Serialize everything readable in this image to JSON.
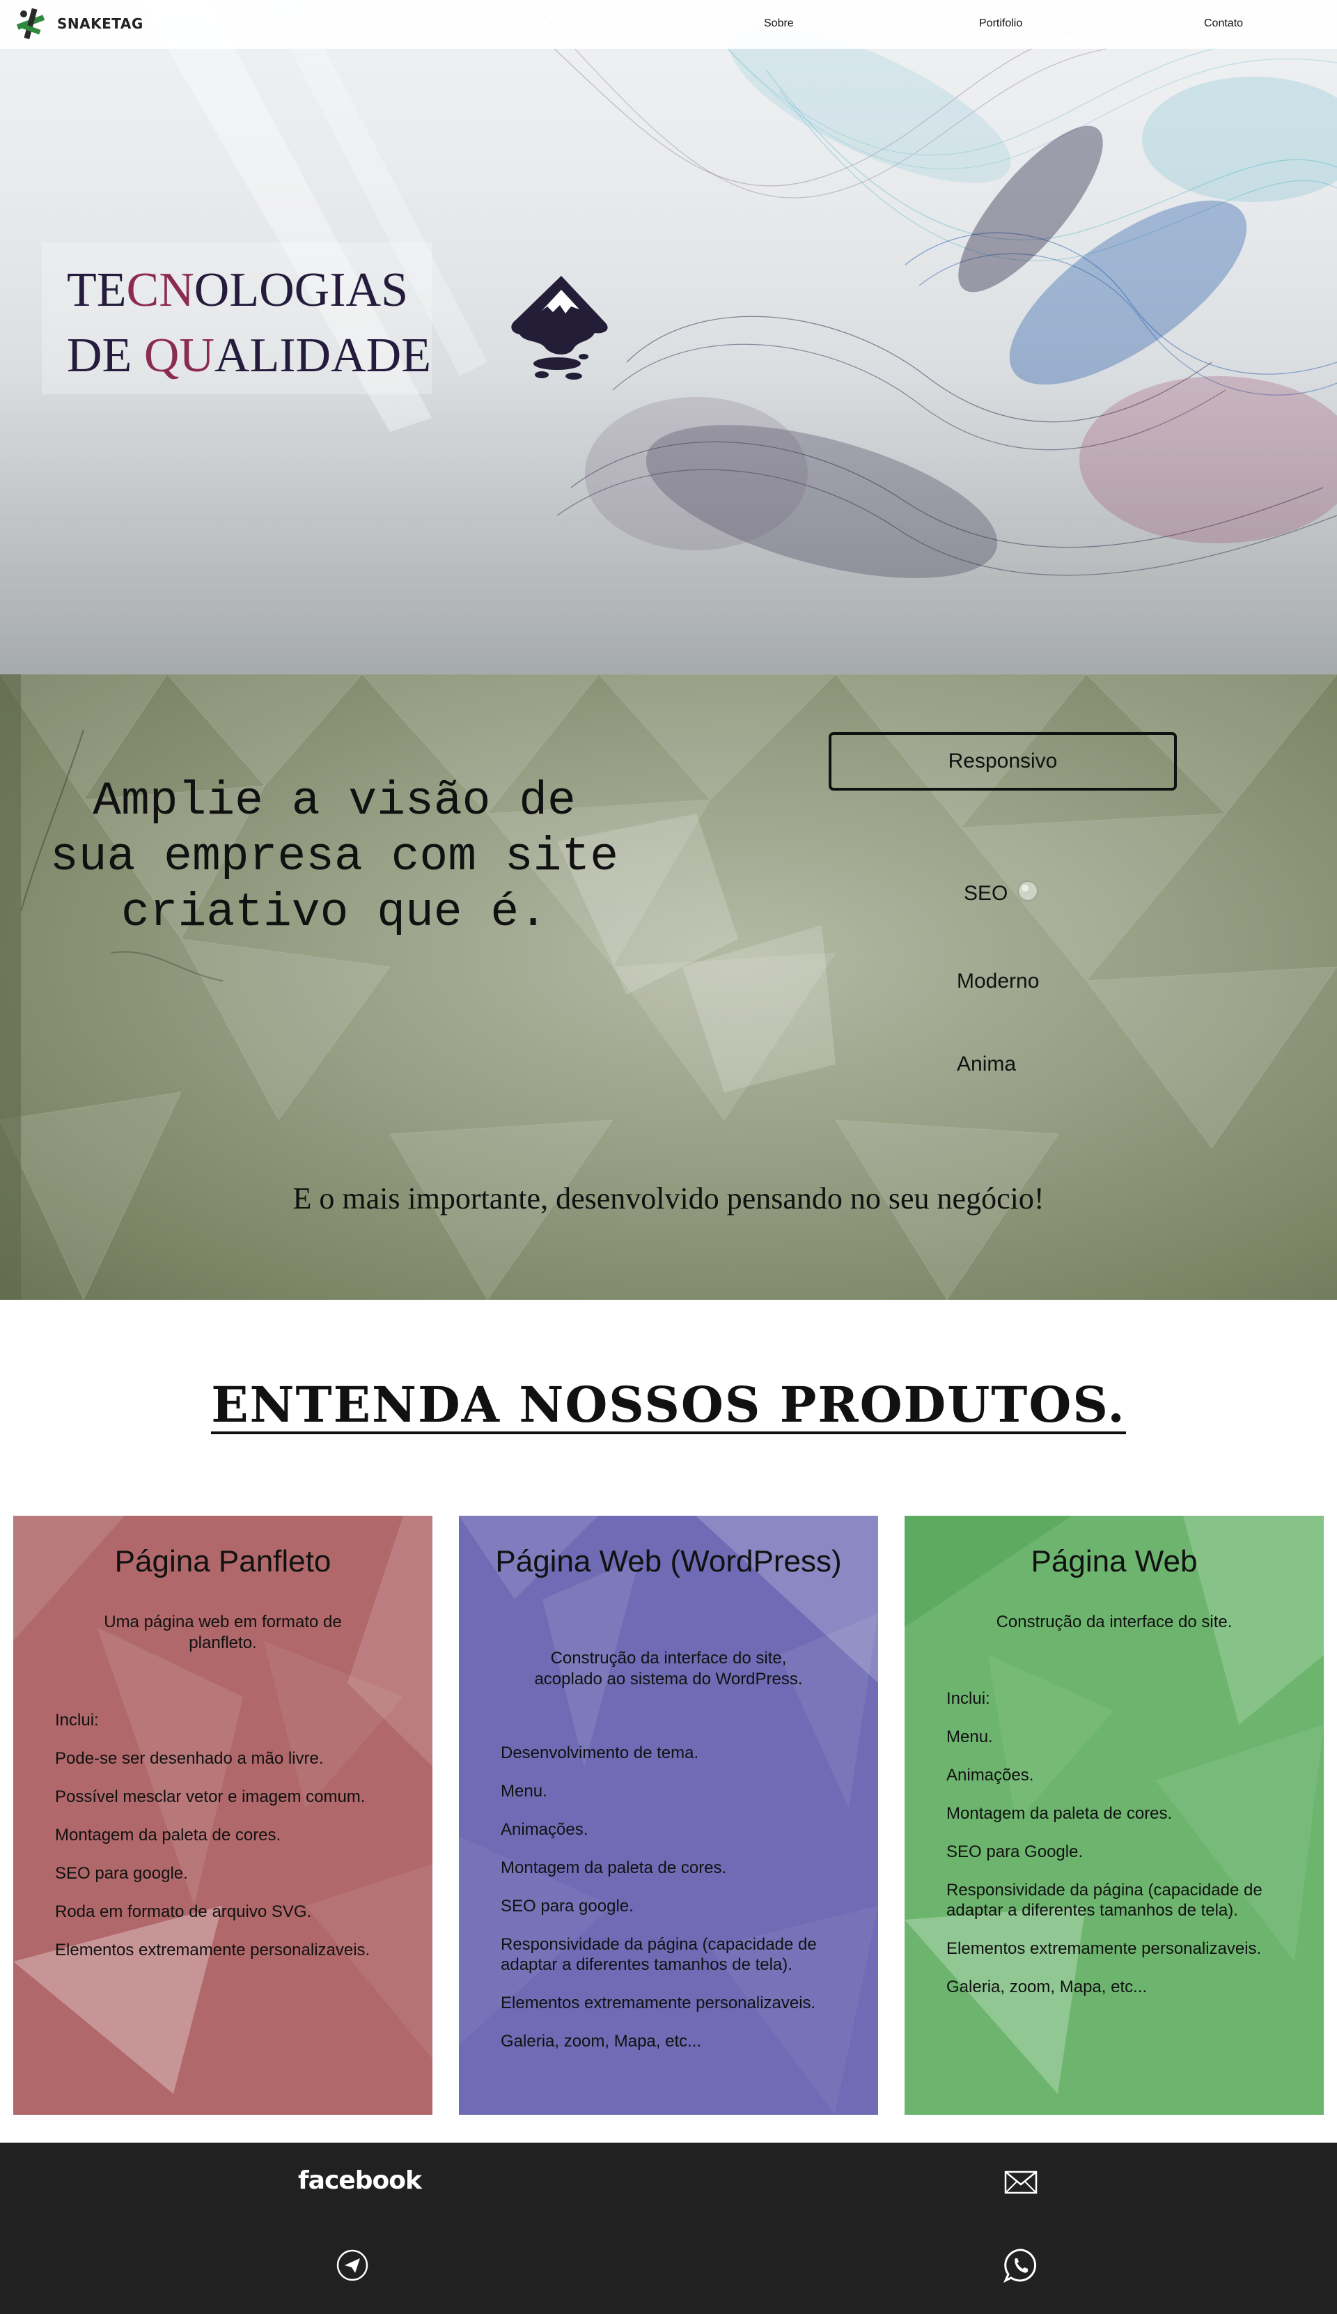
{
  "header": {
    "brand": "SNAKETAG",
    "nav": [
      "Sobre",
      "Portifolio",
      "Contato"
    ]
  },
  "hero": {
    "title_line1": [
      "TE",
      "CN",
      "O",
      "LOGIAS"
    ],
    "title_line2": [
      "DE ",
      "QU",
      "A",
      "LIDADE"
    ],
    "colors": {
      "text": "#251c3d",
      "accent": "#8c2b52"
    }
  },
  "promo": {
    "headline": "Amplie a visão de sua empresa com site criativo que é.",
    "features": [
      "Responsivo",
      "SEO",
      "Moderno",
      "Anima"
    ],
    "tagline": "E o mais importante, desenvolvido pensando no seu negócio!"
  },
  "products": {
    "heading": "ENTENDA NOSSOS PRODUTOS.",
    "cards": [
      {
        "title": "Página Panfleto",
        "subtitle": "Uma página web em formato de planfleto.",
        "items": [
          "Inclui:",
          "Pode-se ser desenhado a mão livre.",
          "Possível mesclar vetor e imagem comum.",
          "Montagem da paleta de cores.",
          "SEO para google.",
          "Roda em formato de arquivo SVG.",
          "Elementos extremamente personalizaveis."
        ],
        "color": "#b0686a"
      },
      {
        "title": "Página Web (WordPress)",
        "subtitle": "Construção da interface do site, acoplado ao sistema do WordPress.",
        "items": [
          "Desenvolvimento de tema.",
          "Menu.",
          "Animações.",
          "Montagem da paleta de cores.",
          "SEO para google.",
          "Responsividade da página (capacidade de adaptar a diferentes tamanhos de tela).",
          "Elementos extremamente personalizaveis.",
          "Galeria, zoom, Mapa, etc..."
        ],
        "color": "#6f6bb5"
      },
      {
        "title": "Página Web",
        "subtitle": "Construção da interface do site.",
        "items": [
          "Inclui:",
          "Menu.",
          "Animações.",
          "Montagem da paleta de cores.",
          "SEO para Google.",
          "Responsividade da página (capacidade de adaptar a diferentes tamanhos de tela).",
          "Elementos extremamente personalizaveis.",
          "Galeria, zoom, Mapa, etc..."
        ],
        "color": "#6db56e"
      }
    ]
  },
  "footer": {
    "facebook": "facebook",
    "icons": [
      "email-icon",
      "telegram-icon",
      "whatsapp-icon"
    ]
  }
}
